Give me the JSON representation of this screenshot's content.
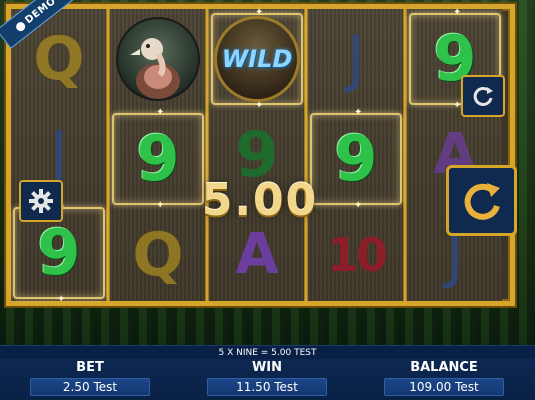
{
  "badge": {
    "label": "DEMO"
  },
  "reels": [
    [
      "Q",
      "J",
      "9"
    ],
    [
      "vulture",
      "9",
      "Q"
    ],
    [
      "WILD",
      "9",
      "A"
    ],
    [
      "J",
      "9",
      "10"
    ],
    [
      "9",
      "A",
      "J"
    ]
  ],
  "wild_label": "WILD",
  "win_display": "5.00",
  "win_line_text": "5 X NINE = 5.00 TEST",
  "stats": {
    "bet": {
      "label": "BET",
      "value": "2.50 Test"
    },
    "win": {
      "label": "WIN",
      "value": "11.50 Test"
    },
    "balance": {
      "label": "BALANCE",
      "value": "109.00 Test"
    }
  },
  "icons": {
    "settings": "gear-icon",
    "autoplay": "refresh-icon",
    "spin": "spin-icon",
    "demo": "info-icon"
  },
  "colors": {
    "frame_gold": "#d6a62a",
    "panel_blue": "#0d2a55",
    "nine_green": "#2fc24a"
  }
}
